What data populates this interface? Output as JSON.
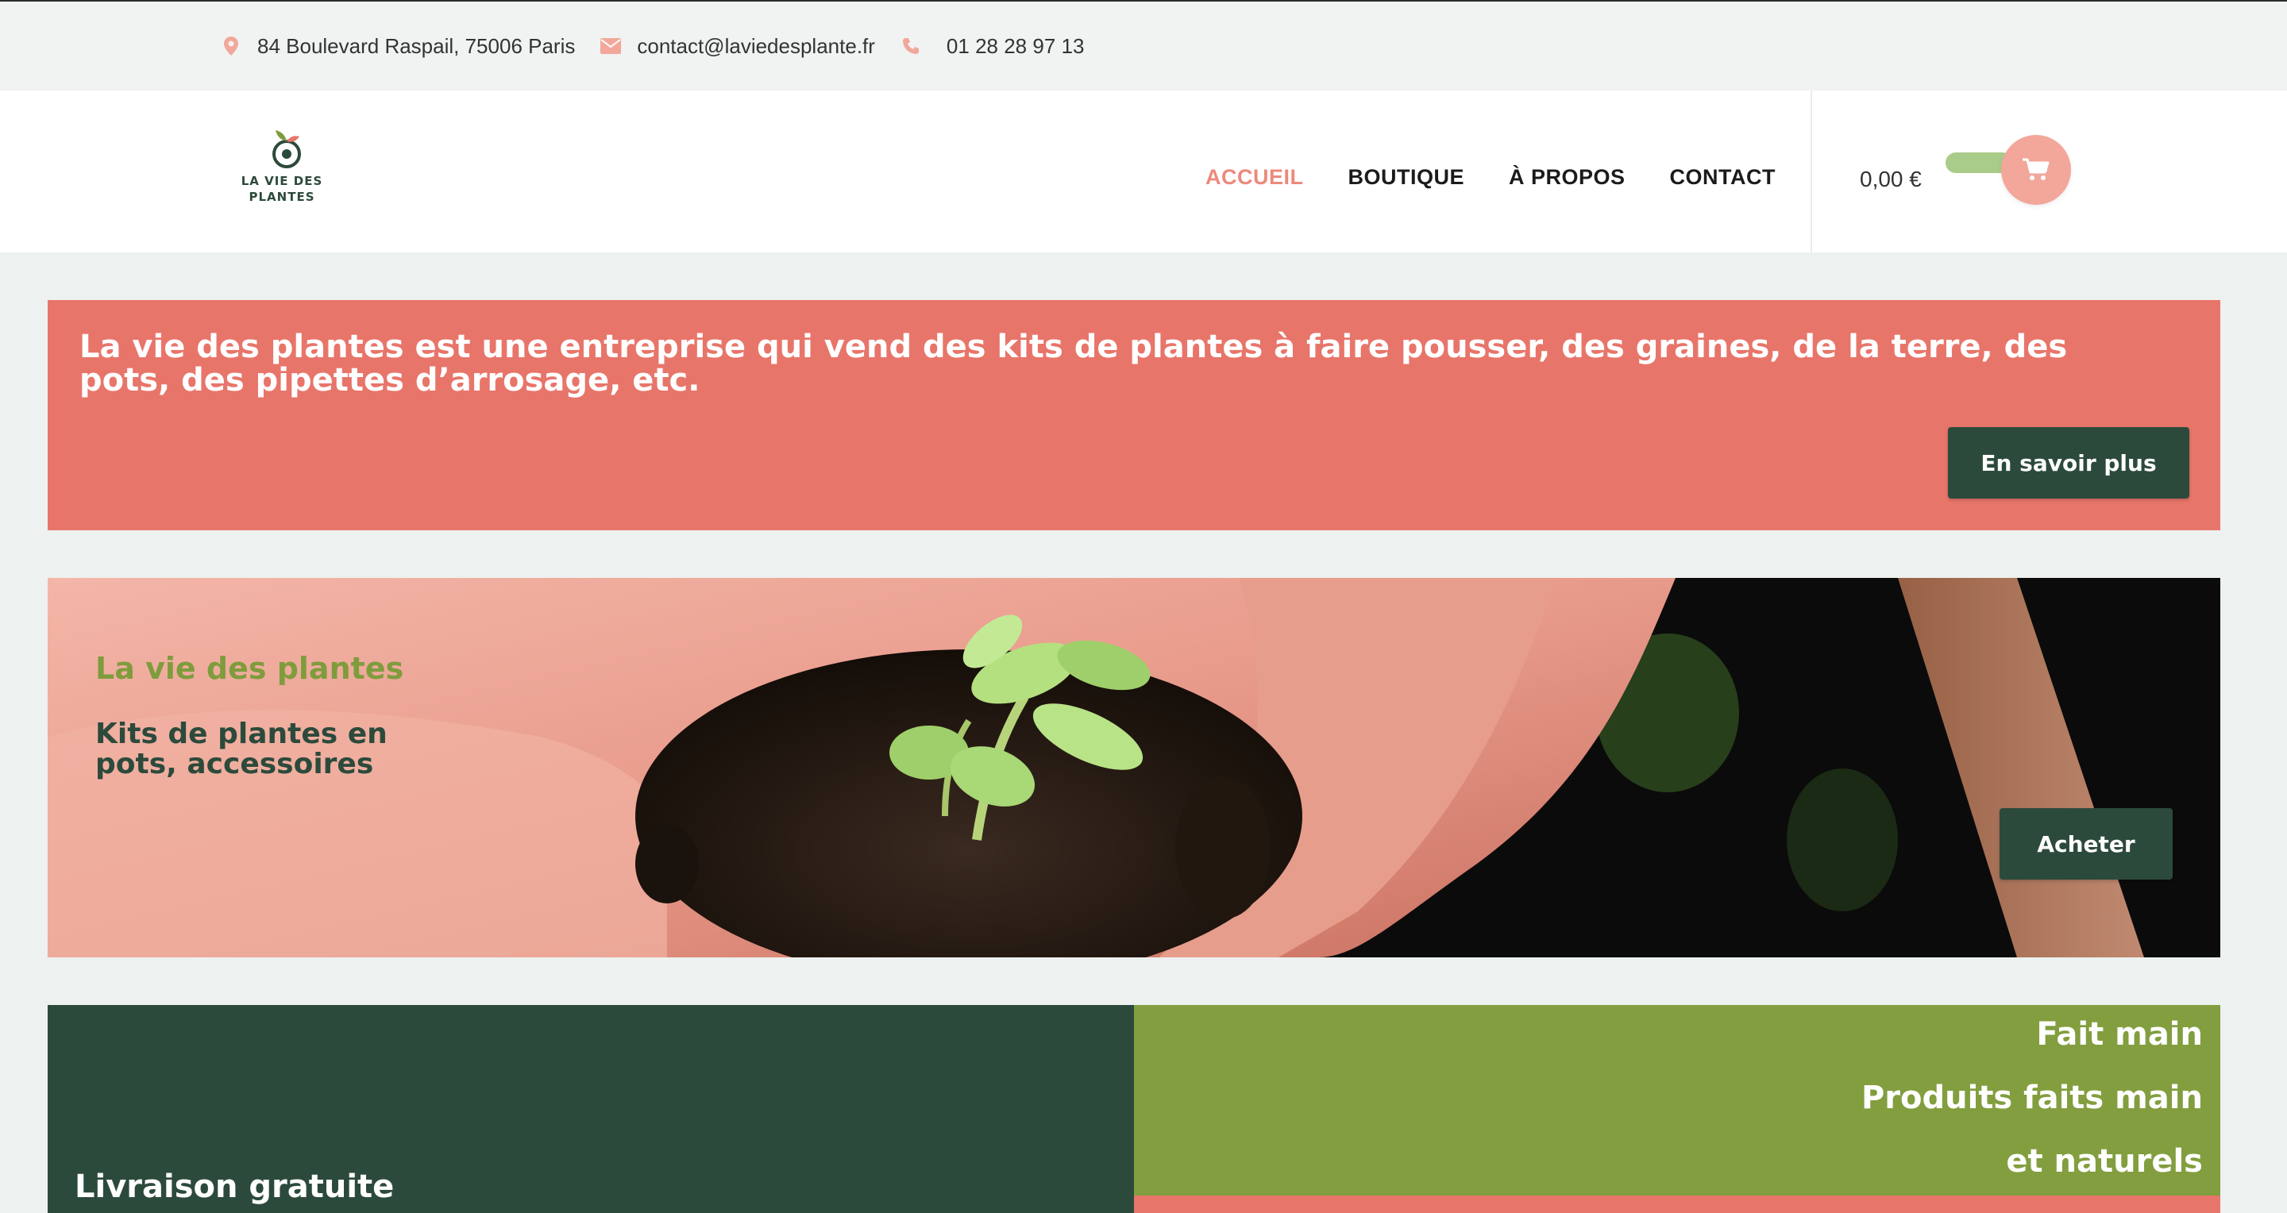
{
  "topbar": {
    "address": "84 Boulevard Raspail, 75006 Paris",
    "email": "contact@laviedesplante.fr",
    "phone": "01 28 28 97 13",
    "icons": [
      "location-pin-icon",
      "envelope-icon",
      "phone-icon"
    ],
    "icon_color": "#f2a79a"
  },
  "header": {
    "logo_text_line1": "LA VIE DES",
    "logo_text_line2": "PLANTES",
    "nav": [
      {
        "label": "ACCUEIL",
        "active": true
      },
      {
        "label": "BOUTIQUE",
        "active": false
      },
      {
        "label": "À PROPOS",
        "active": false
      },
      {
        "label": "CONTACT",
        "active": false
      }
    ],
    "cart_total": "0,00 €",
    "cart_icon": "shopping-cart-icon"
  },
  "banner": {
    "text": "La vie des plantes est une entreprise qui vend des kits de plantes à faire pousser, des graines, de la terre, des pots, des pipettes d’arrosage, etc.",
    "button": "En savoir plus"
  },
  "hero": {
    "title": "La vie des plantes",
    "subtitle": "Kits de plantes en pots, accessoires",
    "button": "Acheter"
  },
  "features": {
    "left_title": "Livraison gratuite",
    "right_lines": [
      "Fait main",
      "Produits faits main",
      "et naturels"
    ]
  },
  "colors": {
    "accent_coral": "#e8756a",
    "dark_green": "#2c4a3c",
    "olive_green": "#829e3f",
    "nav_active": "#ec8a7c"
  }
}
